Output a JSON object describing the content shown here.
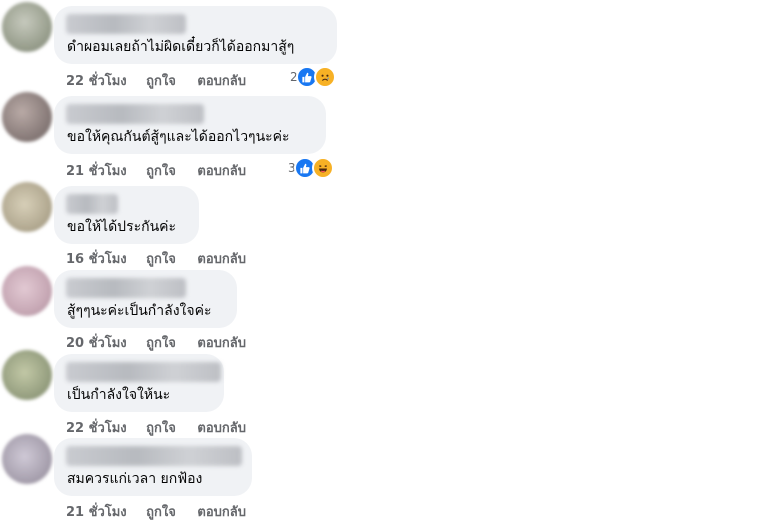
{
  "comments": [
    {
      "text": "ดำผอมเลยถ้าไม่ผิดเดี๋ยวก็ได้ออกมาสู้ๆ",
      "time": "22 ชั่วโมง",
      "like": "ถูกใจ",
      "reply": "ตอบกลับ",
      "reaction_count": "2",
      "reactions": [
        "like-icon",
        "sad-face-icon"
      ],
      "avatar_color": "#9aa08f"
    },
    {
      "text": "ขอให้คุณกันต์สู้ๆและได้ออกไวๆนะค่ะ",
      "time": "21 ชั่วโมง",
      "like": "ถูกใจ",
      "reply": "ตอบกลับ",
      "reaction_count": "3",
      "reactions": [
        "like-icon",
        "haha-face-icon"
      ],
      "avatar_color": "#8a7d7b"
    },
    {
      "text": "ขอให้ได้ประกันค่ะ",
      "time": "16 ชั่วโมง",
      "like": "ถูกใจ",
      "reply": "ตอบกลับ",
      "avatar_color": "#b4ab93"
    },
    {
      "text": "สู้ๆๆนะค่ะเป็นกำลังใจค่ะ",
      "time": "20 ชั่วโมง",
      "like": "ถูกใจ",
      "reply": "ตอบกลับ",
      "avatar_color": "#c7a8b5"
    },
    {
      "text": "เป็นกำลังใจให้นะ",
      "time": "22 ชั่วโมง",
      "like": "ถูกใจ",
      "reply": "ตอบกลับ",
      "avatar_color": "#98a182"
    },
    {
      "text": "สมควรแก่เวลา ยกฟ้อง",
      "time": "21 ชั่วโมง",
      "like": "ถูกใจ",
      "reply": "ตอบกลับ",
      "avatar_color": "#a9a2b0"
    }
  ]
}
